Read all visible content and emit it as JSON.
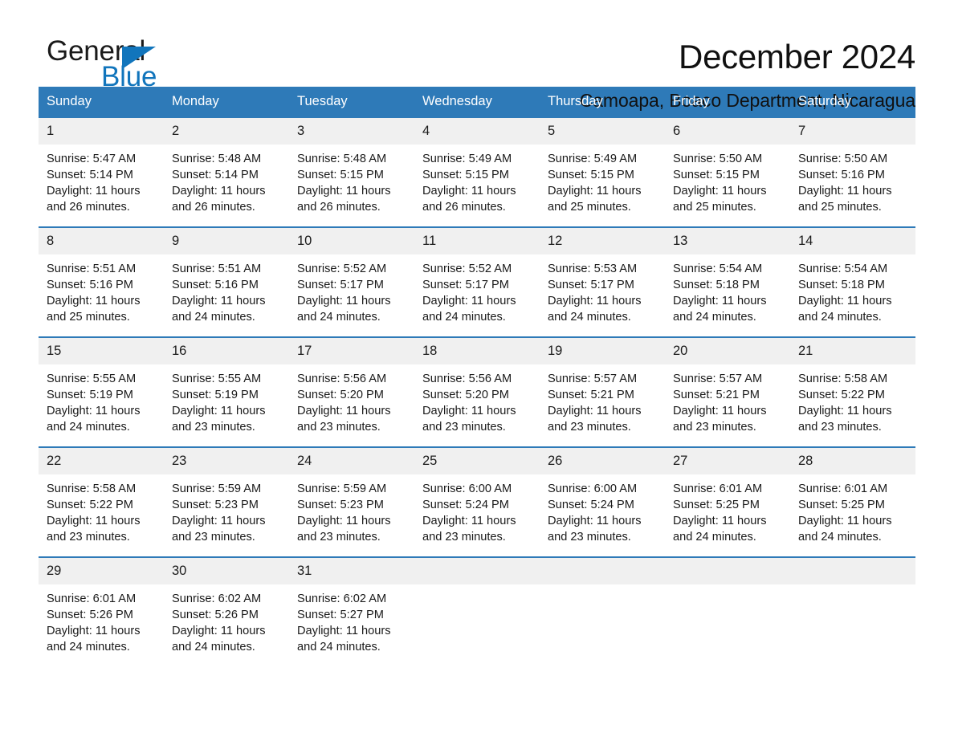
{
  "logo": {
    "word_one": "General",
    "word_two": "Blue",
    "triangle_color": "#1175bc",
    "text_color": "#1a1a1a"
  },
  "header": {
    "title": "December 2024",
    "subtitle": "Camoapa, Boaco Department, Nicaragua"
  },
  "theme": {
    "header_blue": "#2e7ab8",
    "date_band_gray": "#f0f0f0",
    "white": "#ffffff"
  },
  "calendar": {
    "weekdays": [
      "Sunday",
      "Monday",
      "Tuesday",
      "Wednesday",
      "Thursday",
      "Friday",
      "Saturday"
    ],
    "weeks": [
      {
        "days": [
          {
            "num": "1",
            "l1": "Sunrise: 5:47 AM",
            "l2": "Sunset: 5:14 PM",
            "l3": "Daylight: 11 hours",
            "l4": "and 26 minutes."
          },
          {
            "num": "2",
            "l1": "Sunrise: 5:48 AM",
            "l2": "Sunset: 5:14 PM",
            "l3": "Daylight: 11 hours",
            "l4": "and 26 minutes."
          },
          {
            "num": "3",
            "l1": "Sunrise: 5:48 AM",
            "l2": "Sunset: 5:15 PM",
            "l3": "Daylight: 11 hours",
            "l4": "and 26 minutes."
          },
          {
            "num": "4",
            "l1": "Sunrise: 5:49 AM",
            "l2": "Sunset: 5:15 PM",
            "l3": "Daylight: 11 hours",
            "l4": "and 26 minutes."
          },
          {
            "num": "5",
            "l1": "Sunrise: 5:49 AM",
            "l2": "Sunset: 5:15 PM",
            "l3": "Daylight: 11 hours",
            "l4": "and 25 minutes."
          },
          {
            "num": "6",
            "l1": "Sunrise: 5:50 AM",
            "l2": "Sunset: 5:15 PM",
            "l3": "Daylight: 11 hours",
            "l4": "and 25 minutes."
          },
          {
            "num": "7",
            "l1": "Sunrise: 5:50 AM",
            "l2": "Sunset: 5:16 PM",
            "l3": "Daylight: 11 hours",
            "l4": "and 25 minutes."
          }
        ]
      },
      {
        "days": [
          {
            "num": "8",
            "l1": "Sunrise: 5:51 AM",
            "l2": "Sunset: 5:16 PM",
            "l3": "Daylight: 11 hours",
            "l4": "and 25 minutes."
          },
          {
            "num": "9",
            "l1": "Sunrise: 5:51 AM",
            "l2": "Sunset: 5:16 PM",
            "l3": "Daylight: 11 hours",
            "l4": "and 24 minutes."
          },
          {
            "num": "10",
            "l1": "Sunrise: 5:52 AM",
            "l2": "Sunset: 5:17 PM",
            "l3": "Daylight: 11 hours",
            "l4": "and 24 minutes."
          },
          {
            "num": "11",
            "l1": "Sunrise: 5:52 AM",
            "l2": "Sunset: 5:17 PM",
            "l3": "Daylight: 11 hours",
            "l4": "and 24 minutes."
          },
          {
            "num": "12",
            "l1": "Sunrise: 5:53 AM",
            "l2": "Sunset: 5:17 PM",
            "l3": "Daylight: 11 hours",
            "l4": "and 24 minutes."
          },
          {
            "num": "13",
            "l1": "Sunrise: 5:54 AM",
            "l2": "Sunset: 5:18 PM",
            "l3": "Daylight: 11 hours",
            "l4": "and 24 minutes."
          },
          {
            "num": "14",
            "l1": "Sunrise: 5:54 AM",
            "l2": "Sunset: 5:18 PM",
            "l3": "Daylight: 11 hours",
            "l4": "and 24 minutes."
          }
        ]
      },
      {
        "days": [
          {
            "num": "15",
            "l1": "Sunrise: 5:55 AM",
            "l2": "Sunset: 5:19 PM",
            "l3": "Daylight: 11 hours",
            "l4": "and 24 minutes."
          },
          {
            "num": "16",
            "l1": "Sunrise: 5:55 AM",
            "l2": "Sunset: 5:19 PM",
            "l3": "Daylight: 11 hours",
            "l4": "and 23 minutes."
          },
          {
            "num": "17",
            "l1": "Sunrise: 5:56 AM",
            "l2": "Sunset: 5:20 PM",
            "l3": "Daylight: 11 hours",
            "l4": "and 23 minutes."
          },
          {
            "num": "18",
            "l1": "Sunrise: 5:56 AM",
            "l2": "Sunset: 5:20 PM",
            "l3": "Daylight: 11 hours",
            "l4": "and 23 minutes."
          },
          {
            "num": "19",
            "l1": "Sunrise: 5:57 AM",
            "l2": "Sunset: 5:21 PM",
            "l3": "Daylight: 11 hours",
            "l4": "and 23 minutes."
          },
          {
            "num": "20",
            "l1": "Sunrise: 5:57 AM",
            "l2": "Sunset: 5:21 PM",
            "l3": "Daylight: 11 hours",
            "l4": "and 23 minutes."
          },
          {
            "num": "21",
            "l1": "Sunrise: 5:58 AM",
            "l2": "Sunset: 5:22 PM",
            "l3": "Daylight: 11 hours",
            "l4": "and 23 minutes."
          }
        ]
      },
      {
        "days": [
          {
            "num": "22",
            "l1": "Sunrise: 5:58 AM",
            "l2": "Sunset: 5:22 PM",
            "l3": "Daylight: 11 hours",
            "l4": "and 23 minutes."
          },
          {
            "num": "23",
            "l1": "Sunrise: 5:59 AM",
            "l2": "Sunset: 5:23 PM",
            "l3": "Daylight: 11 hours",
            "l4": "and 23 minutes."
          },
          {
            "num": "24",
            "l1": "Sunrise: 5:59 AM",
            "l2": "Sunset: 5:23 PM",
            "l3": "Daylight: 11 hours",
            "l4": "and 23 minutes."
          },
          {
            "num": "25",
            "l1": "Sunrise: 6:00 AM",
            "l2": "Sunset: 5:24 PM",
            "l3": "Daylight: 11 hours",
            "l4": "and 23 minutes."
          },
          {
            "num": "26",
            "l1": "Sunrise: 6:00 AM",
            "l2": "Sunset: 5:24 PM",
            "l3": "Daylight: 11 hours",
            "l4": "and 23 minutes."
          },
          {
            "num": "27",
            "l1": "Sunrise: 6:01 AM",
            "l2": "Sunset: 5:25 PM",
            "l3": "Daylight: 11 hours",
            "l4": "and 24 minutes."
          },
          {
            "num": "28",
            "l1": "Sunrise: 6:01 AM",
            "l2": "Sunset: 5:25 PM",
            "l3": "Daylight: 11 hours",
            "l4": "and 24 minutes."
          }
        ]
      },
      {
        "days": [
          {
            "num": "29",
            "l1": "Sunrise: 6:01 AM",
            "l2": "Sunset: 5:26 PM",
            "l3": "Daylight: 11 hours",
            "l4": "and 24 minutes."
          },
          {
            "num": "30",
            "l1": "Sunrise: 6:02 AM",
            "l2": "Sunset: 5:26 PM",
            "l3": "Daylight: 11 hours",
            "l4": "and 24 minutes."
          },
          {
            "num": "31",
            "l1": "Sunrise: 6:02 AM",
            "l2": "Sunset: 5:27 PM",
            "l3": "Daylight: 11 hours",
            "l4": "and 24 minutes."
          },
          {
            "num": "",
            "l1": "",
            "l2": "",
            "l3": "",
            "l4": ""
          },
          {
            "num": "",
            "l1": "",
            "l2": "",
            "l3": "",
            "l4": ""
          },
          {
            "num": "",
            "l1": "",
            "l2": "",
            "l3": "",
            "l4": ""
          },
          {
            "num": "",
            "l1": "",
            "l2": "",
            "l3": "",
            "l4": ""
          }
        ]
      }
    ]
  }
}
